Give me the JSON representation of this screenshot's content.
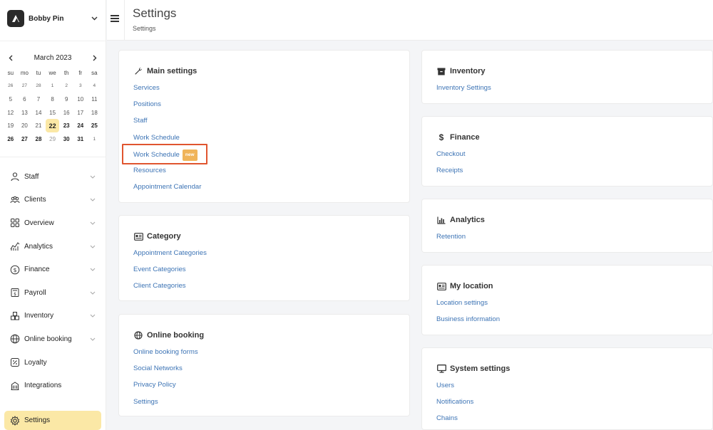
{
  "profile": {
    "name": "Bobby Pin"
  },
  "calendar": {
    "month_label": "March 2023",
    "weekdays": [
      "su",
      "mo",
      "tu",
      "we",
      "th",
      "fr",
      "sa"
    ],
    "weeks": [
      [
        "26",
        "27",
        "28",
        "1",
        "2",
        "3",
        "4"
      ],
      [
        "5",
        "6",
        "7",
        "8",
        "9",
        "10",
        "11"
      ],
      [
        "12",
        "13",
        "14",
        "15",
        "16",
        "17",
        "18"
      ],
      [
        "19",
        "20",
        "21",
        "22",
        "23",
        "24",
        "25"
      ],
      [
        "26",
        "27",
        "28",
        "29",
        "30",
        "31",
        "1"
      ]
    ],
    "today": "22"
  },
  "sidebar": {
    "items": [
      {
        "label": "Staff",
        "icon": "person-icon",
        "has_chevron": true
      },
      {
        "label": "Clients",
        "icon": "people-icon",
        "has_chevron": true
      },
      {
        "label": "Overview",
        "icon": "grid-icon",
        "has_chevron": true
      },
      {
        "label": "Analytics",
        "icon": "chart-icon",
        "has_chevron": true
      },
      {
        "label": "Finance",
        "icon": "dollar-circle-icon",
        "has_chevron": true
      },
      {
        "label": "Payroll",
        "icon": "payroll-icon",
        "has_chevron": true
      },
      {
        "label": "Inventory",
        "icon": "boxes-icon",
        "has_chevron": true
      },
      {
        "label": "Online booking",
        "icon": "globe-icon",
        "has_chevron": true
      },
      {
        "label": "Loyalty",
        "icon": "percent-icon",
        "has_chevron": false
      },
      {
        "label": "Integrations",
        "icon": "building-icon",
        "has_chevron": false
      }
    ],
    "settings_label": "Settings"
  },
  "header": {
    "title": "Settings",
    "breadcrumb": "Settings"
  },
  "cards": {
    "main_settings": {
      "title": "Main settings",
      "icon": "wrench-icon",
      "links": [
        "Services",
        "Positions",
        "Staff",
        "Work Schedule",
        "Work Schedule",
        "Resources",
        "Appointment Calendar"
      ],
      "new_badge": "new"
    },
    "category": {
      "title": "Category",
      "icon": "id-card-icon",
      "links": [
        "Appointment Categories",
        "Event Categories",
        "Client Categories"
      ]
    },
    "online_booking": {
      "title": "Online booking",
      "icon": "globe-icon",
      "links": [
        "Online booking forms",
        "Social Networks",
        "Privacy Policy",
        "Settings"
      ]
    },
    "inventory": {
      "title": "Inventory",
      "icon": "archive-icon",
      "links": [
        "Inventory Settings"
      ]
    },
    "finance": {
      "title": "Finance",
      "icon": "dollar-icon",
      "links": [
        "Checkout",
        "Receipts"
      ]
    },
    "analytics": {
      "title": "Analytics",
      "icon": "bar-chart-icon",
      "links": [
        "Retention"
      ]
    },
    "my_location": {
      "title": "My location",
      "icon": "id-card-icon",
      "links": [
        "Location settings",
        "Business information"
      ]
    },
    "system_settings": {
      "title": "System settings",
      "icon": "monitor-icon",
      "links": [
        "Users",
        "Notifications",
        "Chains"
      ]
    }
  },
  "colors": {
    "accent": "#3d74b5",
    "active_bg": "#fbe8a6",
    "highlight": "#e0552f",
    "badge": "#f0b45a"
  }
}
